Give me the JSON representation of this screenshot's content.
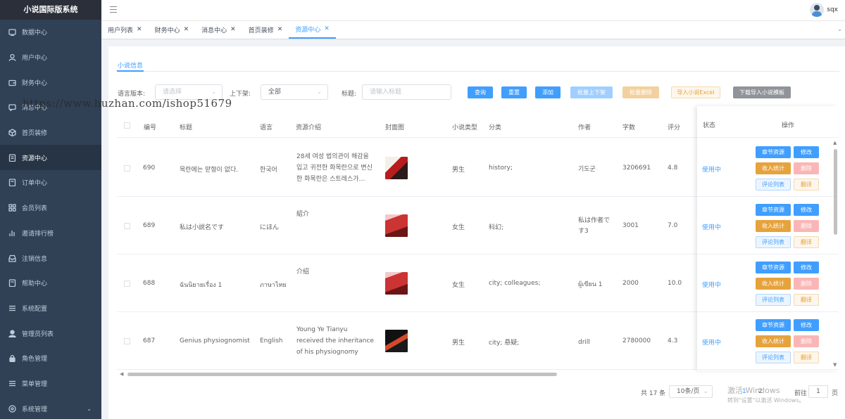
{
  "app_title": "小说国际版系统",
  "user": {
    "name": "sqx"
  },
  "sidebar": {
    "items": [
      {
        "label": "数据中心",
        "icon": "dashboard-icon"
      },
      {
        "label": "用户中心",
        "icon": "user-icon"
      },
      {
        "label": "财务中心",
        "icon": "wallet-icon"
      },
      {
        "label": "消息中心",
        "icon": "message-icon"
      },
      {
        "label": "首页装修",
        "icon": "box-icon"
      },
      {
        "label": "资源中心",
        "icon": "document-icon"
      },
      {
        "label": "订单中心",
        "icon": "order-icon"
      },
      {
        "label": "会员列表",
        "icon": "grid-icon"
      },
      {
        "label": "邀请排行榜",
        "icon": "bar-chart-icon"
      },
      {
        "label": "注销信息",
        "icon": "tray-icon"
      },
      {
        "label": "帮助中心",
        "icon": "help-icon"
      },
      {
        "label": "系统配置",
        "icon": "list-icon"
      },
      {
        "label": "管理员列表",
        "icon": "person-icon"
      },
      {
        "label": "角色管理",
        "icon": "lock-icon"
      },
      {
        "label": "菜单管理",
        "icon": "menu-list-icon"
      },
      {
        "label": "系统管理",
        "icon": "settings-icon"
      }
    ],
    "active": "资源中心"
  },
  "tags": [
    {
      "label": "用户列表"
    },
    {
      "label": "财务中心"
    },
    {
      "label": "消息中心"
    },
    {
      "label": "首页装修"
    },
    {
      "label": "资源中心"
    }
  ],
  "subtab": "小说信息",
  "filters": {
    "lang_label": "语言版本:",
    "lang_placeholder": "请选择",
    "shelf_label": "上下架:",
    "shelf_value": "全部",
    "title_label": "标题:",
    "title_placeholder": "请输入标题"
  },
  "buttons": {
    "query": "查询",
    "reset": "重置",
    "add": "添加",
    "batch_shelf": "批量上下架",
    "batch_delete": "批量删除",
    "import_excel": "导入小说Excel",
    "download_template": "下载导入小说模板"
  },
  "table": {
    "headers": [
      "编号",
      "标题",
      "语言",
      "资源介绍",
      "封面图",
      "小说类型",
      "分类",
      "作者",
      "字数",
      "评分",
      "状态",
      "操作"
    ],
    "rows": [
      {
        "id": "690",
        "title": "목란에는 맏형이 없다.",
        "lang": "한국어",
        "intro": "28세 여성 법의관이 해감을 입고 귀전한 화목란으로 변신한 화목란은 스트레스가…",
        "type": "男生",
        "category": "history;",
        "author": "기도군",
        "words": "3206691",
        "score": "4.8",
        "status": "使用中"
      },
      {
        "id": "689",
        "title": "私は小説名です",
        "lang": "にほん",
        "intro": "紹介",
        "type": "女生",
        "category": "科幻;",
        "author": "私は作者です3",
        "words": "3001",
        "score": "7.0",
        "status": "使用中"
      },
      {
        "id": "688",
        "title": "ฉันนิยายเรื่อง 1",
        "lang": "ภาษาไทย",
        "intro": "介绍",
        "type": "女生",
        "category": "city; colleagues;",
        "author": "ผู้เขียน 1",
        "words": "2000",
        "score": "10.0",
        "status": "使用中"
      },
      {
        "id": "687",
        "title": "Genius physiognomist",
        "lang": "English",
        "intro": "Young Ye Tianyu received the inheritance of his physiognomy teacher, delving in…",
        "type": "男生",
        "category": "city; 悬疑;",
        "author": "drill",
        "words": "2780000",
        "score": "4.3",
        "status": "使用中"
      }
    ],
    "ops": {
      "chapter": "章节资源",
      "edit": "修改",
      "income": "收入统计",
      "delete": "删除",
      "comments": "评论列表",
      "translate": "翻译"
    }
  },
  "pagination": {
    "total": "共 17 条",
    "page_size": "10条/页",
    "pages": [
      "1",
      "2"
    ],
    "goto_label": "前往",
    "goto_value": "1",
    "page_suffix": "页"
  },
  "watermark": {
    "line1": "激活 Windows",
    "line2": "转到\"设置\"以激活 Windows。",
    "url": "https://www.huzhan.com/ishop51679"
  }
}
